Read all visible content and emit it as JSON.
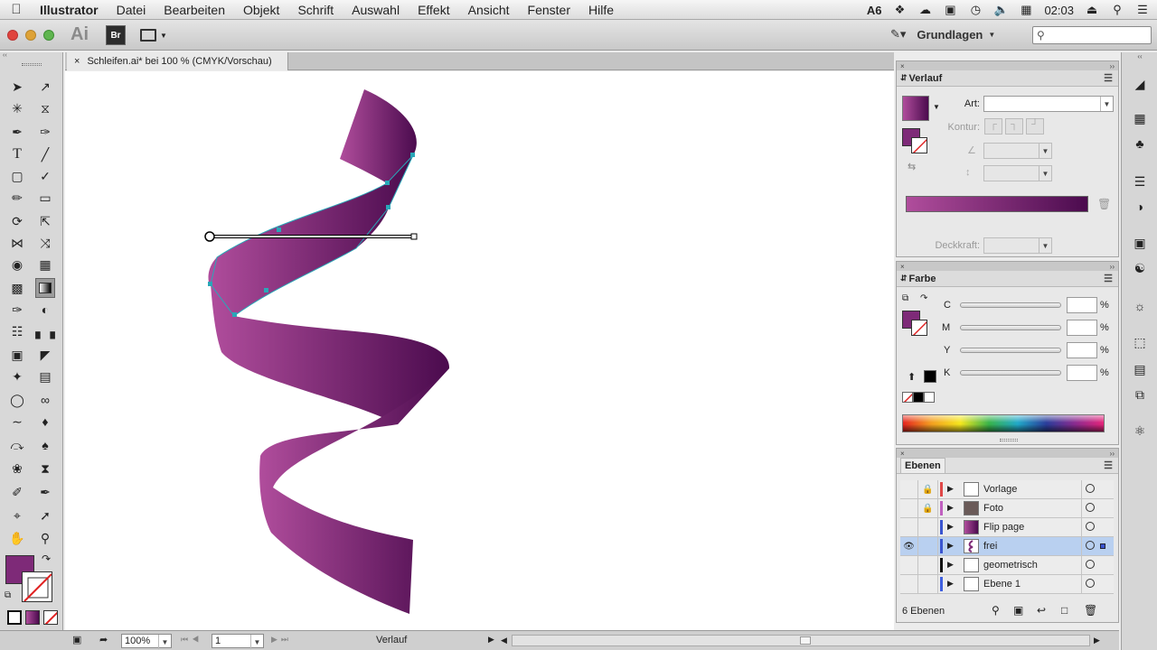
{
  "menubar": {
    "app": "Illustrator",
    "items": [
      "Datei",
      "Bearbeiten",
      "Objekt",
      "Schrift",
      "Auswahl",
      "Effekt",
      "Ansicht",
      "Fenster",
      "Hilfe"
    ],
    "adobe_count": "6",
    "clock": "02:03"
  },
  "appbar": {
    "logo": "Ai",
    "bridge": "Br",
    "workspace": "Grundlagen"
  },
  "document": {
    "tab_title": "Schleifen.ai* bei 100 % (CMYK/Vorschau)"
  },
  "statusbar": {
    "zoom": "100%",
    "artboard": "1",
    "tool": "Verlauf"
  },
  "verlauf_panel": {
    "title": "Verlauf",
    "type_label": "Art:",
    "stroke_label": "Kontur:",
    "opacity_label": "Deckkraft:",
    "gradient_start": "#b04d9c",
    "gradient_end": "#4b0b4e"
  },
  "farbe_panel": {
    "title": "Farbe",
    "channels": [
      {
        "label": "C",
        "value": "",
        "pct": "%"
      },
      {
        "label": "M",
        "value": "",
        "pct": "%"
      },
      {
        "label": "Y",
        "value": "",
        "pct": "%"
      },
      {
        "label": "K",
        "value": "",
        "pct": "%"
      }
    ]
  },
  "ebenen_panel": {
    "title": "Ebenen",
    "layers": [
      {
        "name": "Vorlage",
        "locked": true,
        "visible": false,
        "color": "#e04848"
      },
      {
        "name": "Foto",
        "locked": true,
        "visible": false,
        "color": "#c060c0"
      },
      {
        "name": "Flip page",
        "locked": false,
        "visible": false,
        "color": "#3a55d0"
      },
      {
        "name": "frei",
        "locked": false,
        "visible": true,
        "color": "#3a55d0",
        "selected": true
      },
      {
        "name": "geometrisch",
        "locked": false,
        "visible": false,
        "color": "#111111"
      },
      {
        "name": "Ebene 1",
        "locked": false,
        "visible": false,
        "color": "#4060e0"
      }
    ],
    "count": "6 Ebenen"
  },
  "colors": {
    "fill": "#7e2a78",
    "ribbon_light": "#b04d9c",
    "ribbon_dark": "#4b0b4e"
  }
}
